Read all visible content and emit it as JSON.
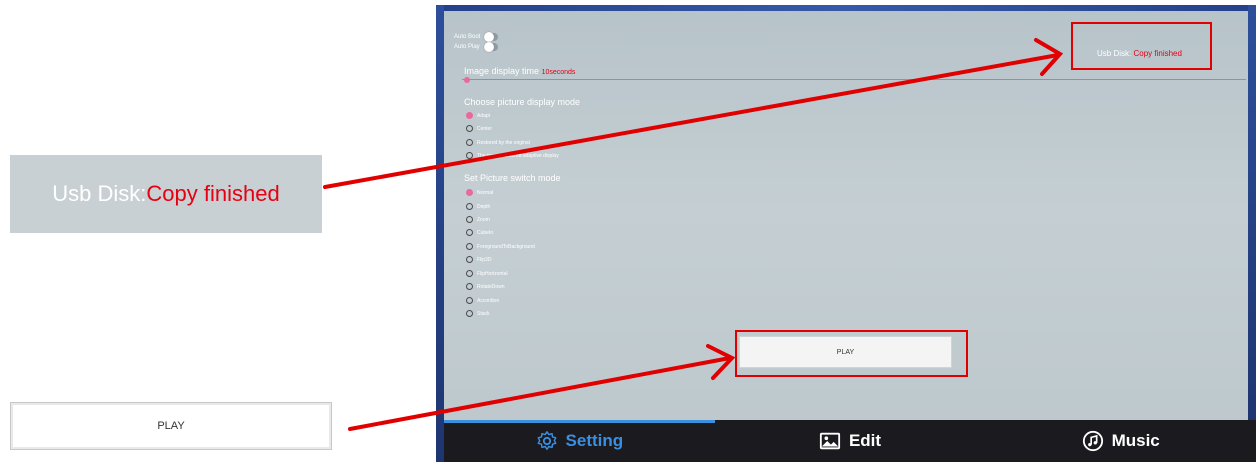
{
  "callouts": {
    "usb_label": "Usb Disk:",
    "usb_value": "Copy finished",
    "play_label": "PLAY"
  },
  "screen": {
    "toggles": [
      {
        "label": "Auto Boot"
      },
      {
        "label": "Auto Play"
      }
    ],
    "display_time": {
      "label": "Image display time",
      "value": "10seconds"
    },
    "usb_status": {
      "label": "Usb Disk:",
      "value": "Copy finished"
    },
    "display_mode": {
      "title": "Choose picture display mode",
      "options": [
        {
          "label": "Adapt",
          "selected": true
        },
        {
          "label": "Center",
          "selected": false
        },
        {
          "label": "Restored by the original",
          "selected": false
        },
        {
          "label": "The image centered adaptive display",
          "selected": false
        }
      ]
    },
    "switch_mode": {
      "title": "Set Picture switch mode",
      "options": [
        {
          "label": "Normal",
          "selected": true
        },
        {
          "label": "Depth",
          "selected": false
        },
        {
          "label": "Zoom",
          "selected": false
        },
        {
          "label": "CubeIn",
          "selected": false
        },
        {
          "label": "ForegroundToBackground",
          "selected": false
        },
        {
          "label": "Flip3D",
          "selected": false
        },
        {
          "label": "FlipHorizontal",
          "selected": false
        },
        {
          "label": "RotateDown",
          "selected": false
        },
        {
          "label": "Accordion",
          "selected": false
        },
        {
          "label": "Stack",
          "selected": false
        }
      ]
    },
    "play_button": "PLAY",
    "tabs": [
      {
        "label": "Setting",
        "icon": "gear-icon",
        "active": true
      },
      {
        "label": "Edit",
        "icon": "image-icon",
        "active": false
      },
      {
        "label": "Music",
        "icon": "music-icon",
        "active": false
      }
    ]
  },
  "colors": {
    "accent": "#3a8fe0",
    "status_red": "#e60012",
    "radio_selected": "#e86a9a",
    "annotation_red": "#e00000"
  }
}
